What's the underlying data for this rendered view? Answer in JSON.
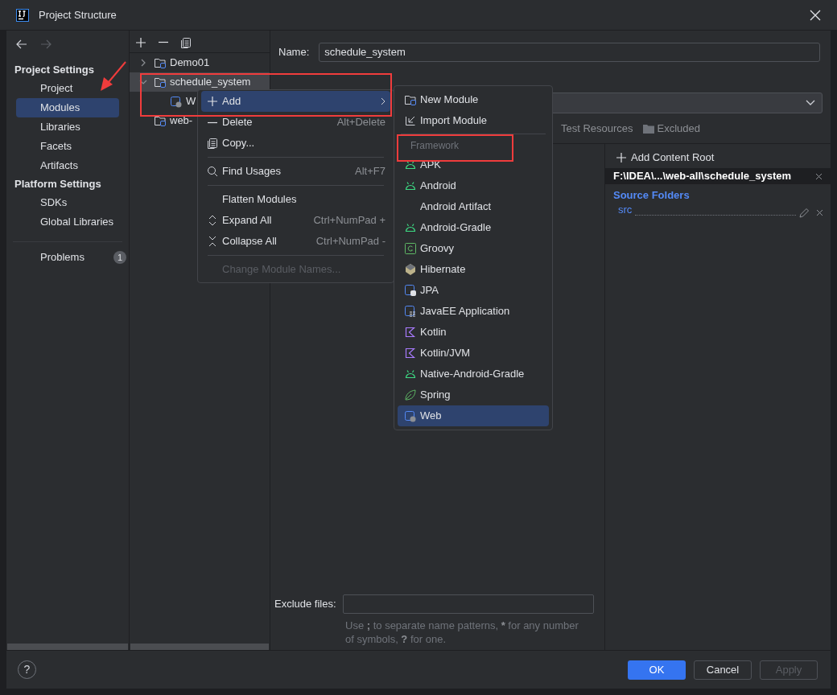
{
  "window": {
    "title": "Project Structure"
  },
  "sidebar": {
    "sections": [
      {
        "title": "Project Settings",
        "items": [
          {
            "label": "Project",
            "selected": false
          },
          {
            "label": "Modules",
            "selected": true
          },
          {
            "label": "Libraries",
            "selected": false
          },
          {
            "label": "Facets",
            "selected": false
          },
          {
            "label": "Artifacts",
            "selected": false
          }
        ]
      },
      {
        "title": "Platform Settings",
        "items": [
          {
            "label": "SDKs",
            "selected": false
          },
          {
            "label": "Global Libraries",
            "selected": false
          }
        ]
      }
    ],
    "problems": {
      "label": "Problems",
      "count": "1"
    }
  },
  "tree": {
    "items": [
      {
        "label": "Demo01",
        "kind": "module",
        "expanded": false,
        "selected": false
      },
      {
        "label": "schedule_system",
        "kind": "module",
        "expanded": true,
        "selected": true,
        "children": [
          {
            "label": "W",
            "kind": "web",
            "selected": false
          }
        ]
      },
      {
        "label": "web-",
        "kind": "module",
        "selected": false
      }
    ]
  },
  "module": {
    "name_label": "Name:",
    "name_value": "schedule_system",
    "folder_tags": [
      {
        "label": "Test Resources",
        "kind": "test"
      },
      {
        "label": "Excluded",
        "kind": "excluded"
      }
    ],
    "content_root": {
      "add_label": "Add Content Root",
      "path": "F:\\IDEA\\...\\web-all\\schedule_system",
      "source_folders_title": "Source Folders",
      "source_folders": [
        "src"
      ]
    },
    "exclude_files": {
      "label": "Exclude files:",
      "hint": [
        {
          "text": "Use ",
          "bold": false
        },
        {
          "text": ";",
          "bold": true
        },
        {
          "text": " to separate name patterns, ",
          "bold": false
        },
        {
          "text": "*",
          "bold": true
        },
        {
          "text": " for any number of symbols, ",
          "bold": false
        },
        {
          "text": "?",
          "bold": true
        },
        {
          "text": " for one.",
          "bold": false
        }
      ]
    }
  },
  "context_menu": {
    "items": [
      {
        "kind": "add",
        "label": "Add",
        "selected": true,
        "disabled": false,
        "submenu": true
      },
      {
        "kind": "delete",
        "label": "Delete",
        "shortcut": "Alt+Delete",
        "selected": false,
        "disabled": false,
        "submenu": false
      },
      {
        "kind": "copy",
        "label": "Copy...",
        "selected": false,
        "disabled": false,
        "submenu": false
      },
      {
        "kind": "separator"
      },
      {
        "kind": "find",
        "label": "Find Usages",
        "shortcut": "Alt+F7",
        "selected": false,
        "disabled": false,
        "submenu": false
      },
      {
        "kind": "separator"
      },
      {
        "kind": "plain",
        "label": "Flatten Modules",
        "selected": false,
        "disabled": false,
        "submenu": false
      },
      {
        "kind": "expand",
        "label": "Expand All",
        "shortcut": "Ctrl+NumPad +",
        "selected": false,
        "disabled": false,
        "submenu": false
      },
      {
        "kind": "collapse",
        "label": "Collapse All",
        "shortcut": "Ctrl+NumPad -",
        "selected": false,
        "disabled": false,
        "submenu": false
      },
      {
        "kind": "separator"
      },
      {
        "kind": "plain",
        "label": "Change Module Names...",
        "selected": false,
        "disabled": true,
        "submenu": false
      }
    ]
  },
  "submenu": {
    "items": [
      {
        "kind": "module",
        "label": "New Module",
        "selected": false
      },
      {
        "kind": "import",
        "label": "Import Module",
        "selected": false
      },
      {
        "kind": "separator"
      },
      {
        "kind": "header",
        "label": "Framework"
      },
      {
        "kind": "android",
        "label": "APK",
        "selected": false
      },
      {
        "kind": "android",
        "label": "Android",
        "selected": false
      },
      {
        "kind": "plain",
        "label": "Android Artifact",
        "selected": false
      },
      {
        "kind": "android",
        "label": "Android-Gradle",
        "selected": false
      },
      {
        "kind": "groovy",
        "label": "Groovy",
        "selected": false
      },
      {
        "kind": "hibernate",
        "label": "Hibernate",
        "selected": false
      },
      {
        "kind": "jpa",
        "label": "JPA",
        "selected": false
      },
      {
        "kind": "javaee",
        "label": "JavaEE Application",
        "selected": false
      },
      {
        "kind": "kotlin",
        "label": "Kotlin",
        "selected": false
      },
      {
        "kind": "kotlin",
        "label": "Kotlin/JVM",
        "selected": false
      },
      {
        "kind": "android",
        "label": "Native-Android-Gradle",
        "selected": false
      },
      {
        "kind": "spring",
        "label": "Spring",
        "selected": false
      },
      {
        "kind": "web",
        "label": "Web",
        "selected": true
      }
    ]
  },
  "help": "?",
  "buttons": [
    {
      "label": "OK",
      "kind": "primary",
      "disabled": false
    },
    {
      "label": "Cancel",
      "kind": "default",
      "disabled": false
    },
    {
      "label": "Apply",
      "kind": "default",
      "disabled": true
    }
  ]
}
